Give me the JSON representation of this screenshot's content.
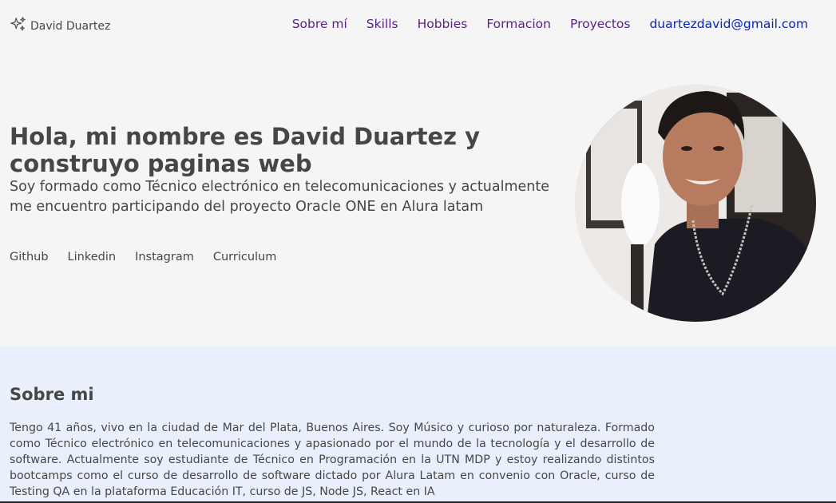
{
  "header": {
    "brand": "David Duartez",
    "brand_icon": "sparkles-icon",
    "nav": [
      {
        "label": "Sobre mí"
      },
      {
        "label": "Skills"
      },
      {
        "label": "Hobbies"
      },
      {
        "label": "Formacion"
      },
      {
        "label": "Proyectos"
      }
    ],
    "email": "duartezdavid@gmail.com"
  },
  "hero": {
    "title": "Hola, mi nombre es David Duartez y construyo paginas web",
    "description": "Soy formado como Técnico electrónico en telecomunicaciones y actualmente me encuentro participando del proyecto Oracle ONE en Alura latam",
    "links": [
      {
        "label": "Github"
      },
      {
        "label": "Linkedin"
      },
      {
        "label": "Instagram"
      },
      {
        "label": "Curriculum"
      }
    ]
  },
  "about": {
    "title": "Sobre mi",
    "text": "Tengo 41 años, vivo en la ciudad de Mar del Plata, Buenos Aires. Soy Músico y curioso por naturaleza. Formado como Técnico electrónico en telecomunicaciones y apasionado por el mundo de la tecnología y el desarrollo de software. Actualmente soy estudiante de Técnico en Programación en la UTN MDP y estoy realizando distintos bootcamps como el curso de desarrollo de software dictado por Alura Latam en convenio con Oracle, curso de Testing QA en la plataforma Educación IT, curso de JS, Node JS, React en IA"
  },
  "colors": {
    "nav_link": "#5b1e8a",
    "email_link": "#0a24b8",
    "text": "#464646",
    "about_bg": "#eaf0fb",
    "page_bg": "#f5f5f5"
  }
}
